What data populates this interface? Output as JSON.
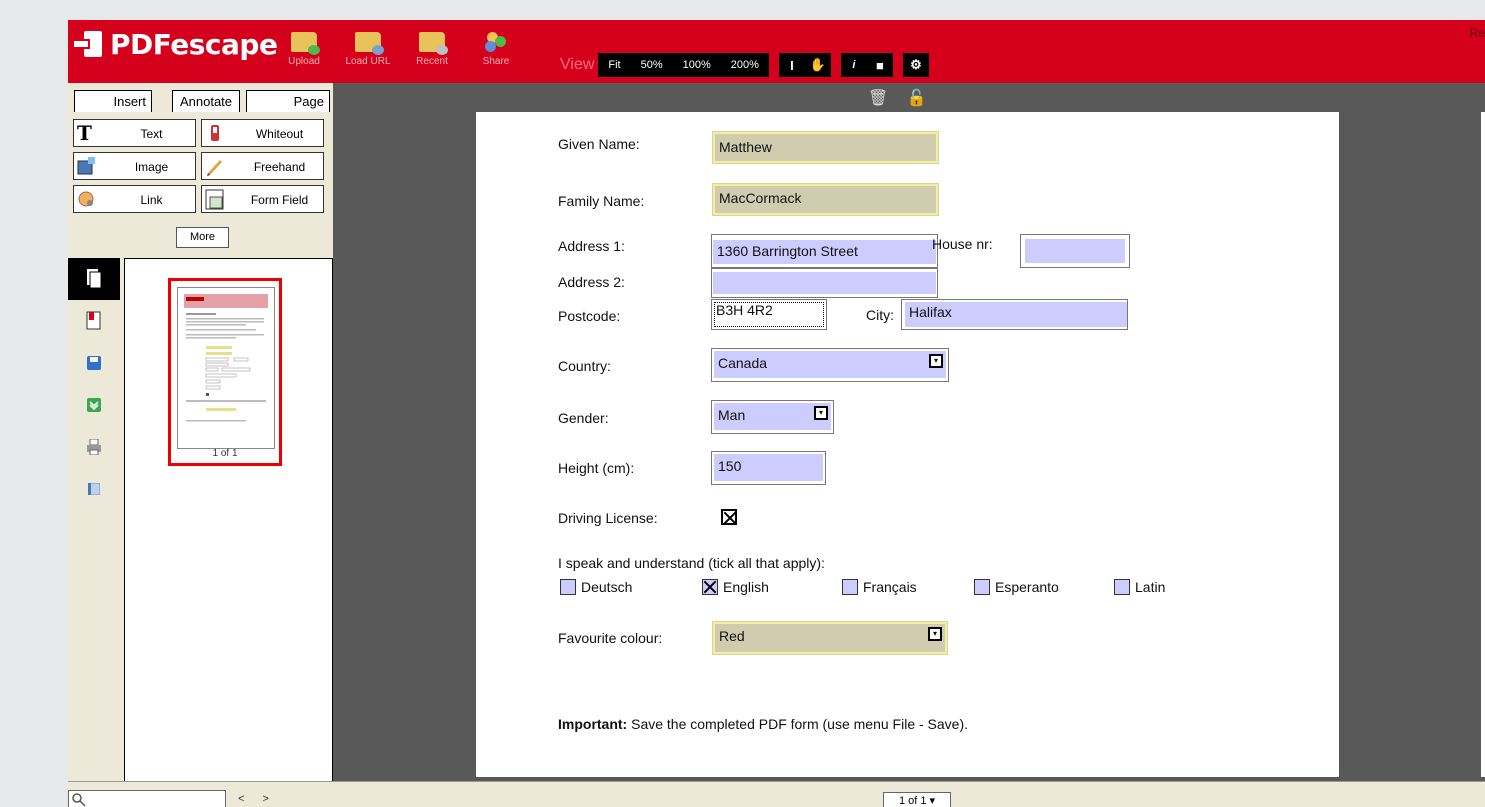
{
  "app": {
    "logo": "PDFescape",
    "top_right_text": "Re"
  },
  "toolbar": {
    "upload": "Upload",
    "load_url": "Load URL",
    "recent": "Recent",
    "share": "Share"
  },
  "viewbar": {
    "label": "View",
    "fit": "Fit",
    "zoom50": "50%",
    "zoom100": "100%",
    "zoom200": "200%"
  },
  "tabs": {
    "insert": "Insert",
    "annotate": "Annotate",
    "page": "Page"
  },
  "tools": {
    "text": "Text",
    "whiteout": "Whiteout",
    "image": "Image",
    "freehand": "Freehand",
    "link": "Link",
    "form_field": "Form Field",
    "more": "More"
  },
  "thumbnail": {
    "label": "1 of 1"
  },
  "bottombar": {
    "page_select": "1 of 1 ▾"
  },
  "form": {
    "given_name_label": "Given Name:",
    "given_name": "Matthew",
    "family_name_label": "Family Name:",
    "family_name": "MacCormack",
    "address1_label": "Address 1:",
    "address1": "1360 Barrington Street",
    "house_nr_label": "House nr:",
    "house_nr": "",
    "address2_label": "Address 2:",
    "address2": "",
    "postcode_label": "Postcode:",
    "postcode": "B3H 4R2",
    "city_label": "City:",
    "city": "Halifax",
    "country_label": "Country:",
    "country": "Canada",
    "gender_label": "Gender:",
    "gender": "Man",
    "height_label": "Height (cm):",
    "height": "150",
    "driving_license_label": "Driving License:",
    "driving_license_checked": true,
    "languages_label": "I speak and understand (tick all that apply):",
    "languages": [
      {
        "name": "Deutsch",
        "checked": false
      },
      {
        "name": "English",
        "checked": true
      },
      {
        "name": "Français",
        "checked": false
      },
      {
        "name": "Esperanto",
        "checked": false
      },
      {
        "name": "Latin",
        "checked": false
      }
    ],
    "colour_label": "Favourite colour:",
    "colour": "Red",
    "important_bold": "Important:",
    "important_text": " Save the completed PDF form (use menu File - Save)."
  },
  "colors": {
    "brand_red": "#d5001c",
    "field_yellow": "#cfccb0",
    "field_blue": "#ccccff"
  }
}
